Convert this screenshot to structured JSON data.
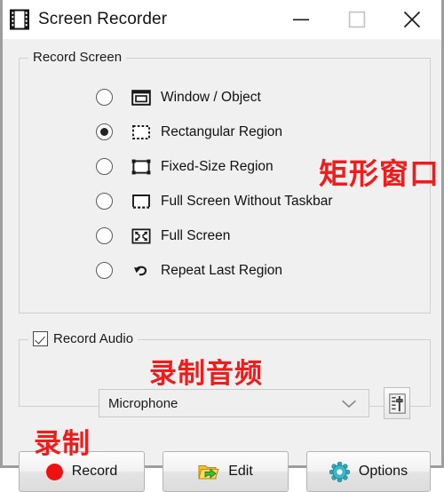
{
  "window": {
    "title": "Screen Recorder",
    "icon": "film-strip-icon",
    "controls": {
      "minimize": "—",
      "maximize": "□",
      "close": "✕"
    }
  },
  "record_screen": {
    "caption": "Record Screen",
    "options": [
      {
        "label": "Window / Object",
        "icon": "window-object-icon",
        "selected": false
      },
      {
        "label": "Rectangular Region",
        "icon": "rectangular-region-icon",
        "selected": true
      },
      {
        "label": "Fixed-Size Region",
        "icon": "fixed-size-region-icon",
        "selected": false
      },
      {
        "label": "Full Screen Without Taskbar",
        "icon": "full-screen-no-taskbar-icon",
        "selected": false
      },
      {
        "label": "Full Screen",
        "icon": "full-screen-icon",
        "selected": false
      },
      {
        "label": "Repeat Last Region",
        "icon": "repeat-last-region-icon",
        "selected": false
      }
    ]
  },
  "record_audio": {
    "caption": "Record Audio",
    "checked": true,
    "device": {
      "selected": "Microphone",
      "options": [
        "Microphone"
      ]
    },
    "mixer_button": "audio-mixer-icon"
  },
  "buttons": {
    "record": "Record",
    "edit": "Edit",
    "options": "Options"
  },
  "annotations": {
    "rectangular_region": "矩形窗口",
    "record_audio": "录制音频",
    "record": "录制",
    "color": "#f01c1c"
  },
  "colors": {
    "window_background": "#f0f0f0",
    "titlebar_background": "#ffffff",
    "record_dot": "#ee1111",
    "annotation_red": "#f01c1c",
    "options_gear": "#2fa8b8",
    "edit_folder": "#f0c020"
  }
}
